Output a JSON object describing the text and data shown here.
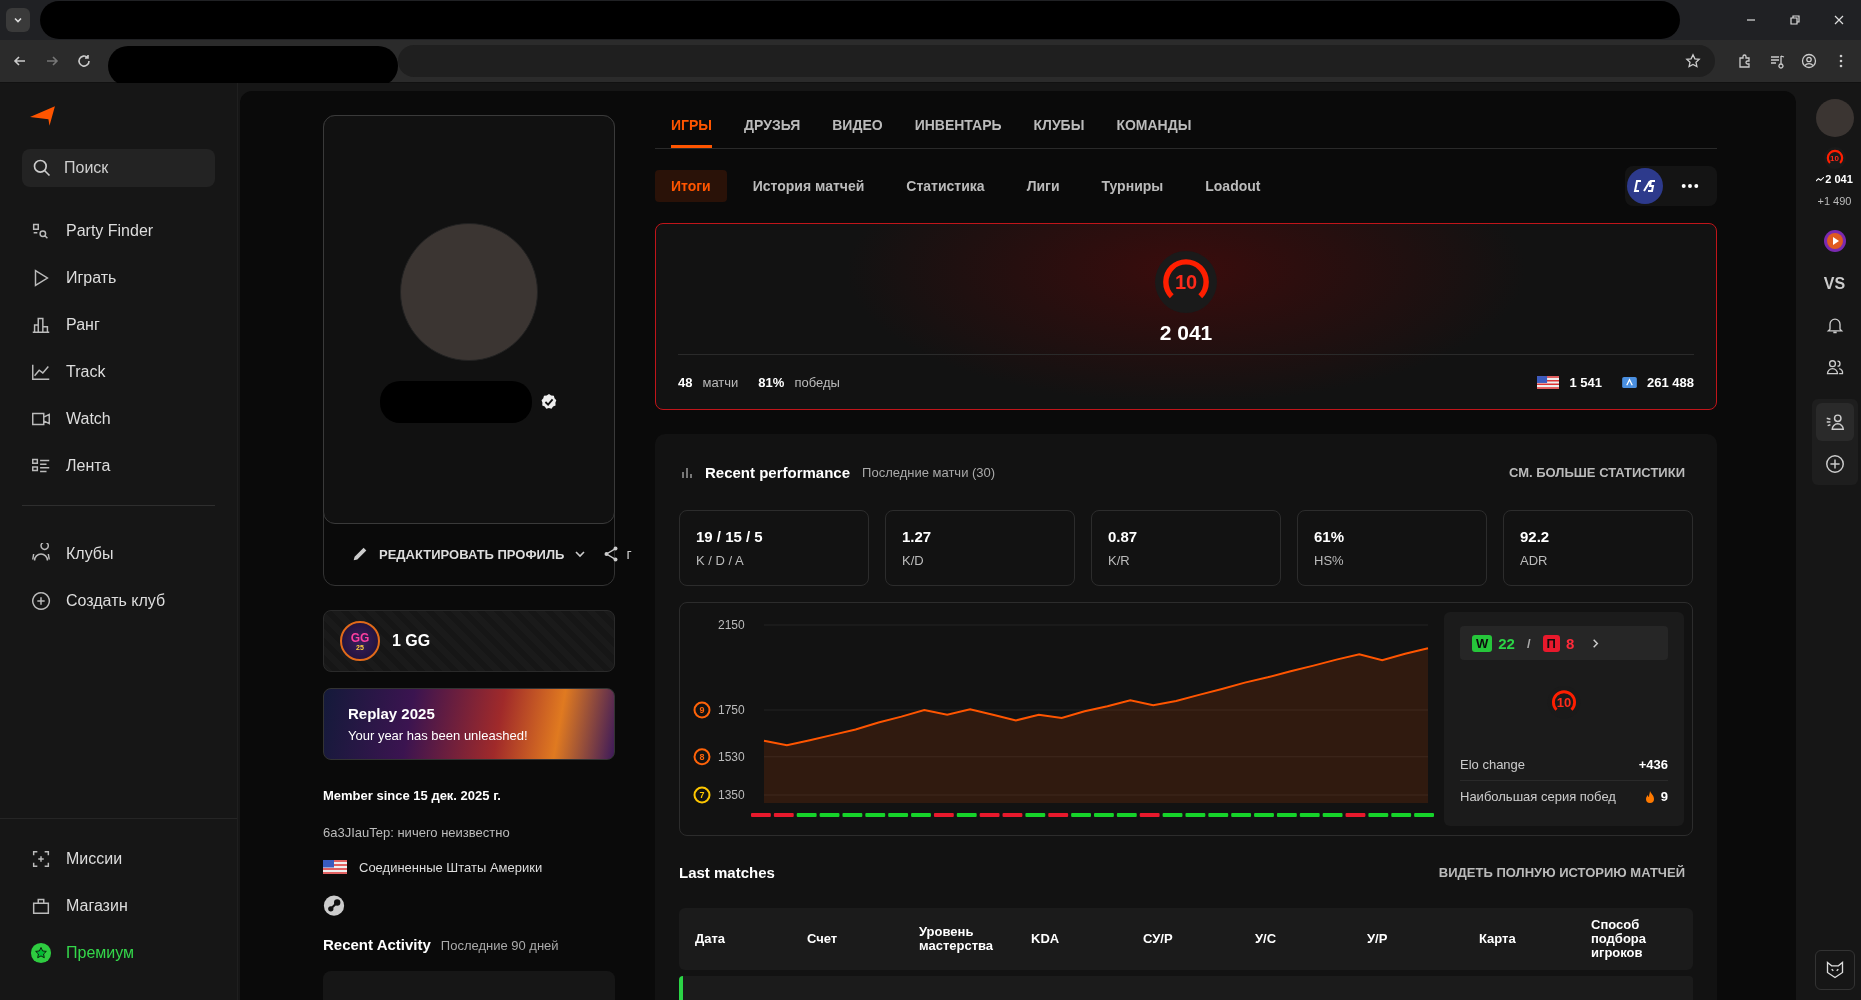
{
  "sidebar": {
    "search": {
      "placeholder": "Поиск"
    },
    "nav": [
      {
        "label": "Party Finder"
      },
      {
        "label": "Играть"
      },
      {
        "label": "Ранг"
      },
      {
        "label": "Track"
      },
      {
        "label": "Watch"
      },
      {
        "label": "Лента"
      }
    ],
    "clubs": [
      {
        "label": "Клубы"
      },
      {
        "label": "Создать клуб"
      }
    ],
    "bottom": [
      {
        "label": "Миссии",
        "kind": "normal"
      },
      {
        "label": "Магазин",
        "kind": "normal"
      },
      {
        "label": "Премиум",
        "kind": "premium"
      }
    ]
  },
  "profile": {
    "verified": true,
    "edit_button": "РЕДАКТИРОВАТЬ ПРОФИЛЬ",
    "share_label": "г",
    "gg_card": {
      "badge": "GG",
      "badge_year": "25",
      "label": "1 GG"
    },
    "replay": {
      "title": "Replay 2025",
      "subtitle": "Your year has been unleashed!"
    },
    "member_since": "Member since 15 дек. 2025 г.",
    "about": "6a3JIauTep: ничего неизвестно",
    "country": "Соединенные Штаты Америки",
    "recent_activity": {
      "title": "Recent Activity",
      "period": "Последние 90 дней"
    }
  },
  "tabs": [
    {
      "label": "ИГРЫ",
      "selected": true
    },
    {
      "label": "ДРУЗЬЯ",
      "selected": false
    },
    {
      "label": "ВИДЕО",
      "selected": false
    },
    {
      "label": "ИНВЕНТАРЬ",
      "selected": false
    },
    {
      "label": "КЛУБЫ",
      "selected": false
    },
    {
      "label": "КОМАНДЫ",
      "selected": false
    }
  ],
  "subtabs": [
    {
      "label": "Итоги",
      "selected": true
    },
    {
      "label": "История матчей",
      "selected": false
    },
    {
      "label": "Статистика",
      "selected": false
    },
    {
      "label": "Лиги",
      "selected": false
    },
    {
      "label": "Турниры",
      "selected": false
    },
    {
      "label": "Loadout",
      "selected": false
    }
  ],
  "rank": {
    "level": "10",
    "elo": "2 041",
    "matches": "48",
    "matches_label": "матчи",
    "winrate": "81%",
    "winrate_label": "победы",
    "country_rank": "1 541",
    "region_rank": "261 488"
  },
  "performance": {
    "title": "Recent performance",
    "subtitle": "Последние матчи (30)",
    "more_link": "СМ. БОЛЬШЕ СТАТИСТИКИ",
    "stats": [
      {
        "value": "19 / 15 / 5",
        "label": "K / D / A"
      },
      {
        "value": "1.27",
        "label": "K/D"
      },
      {
        "value": "0.87",
        "label": "K/R"
      },
      {
        "value": "61%",
        "label": "HS%"
      },
      {
        "value": "92.2",
        "label": "ADR"
      }
    ],
    "chart_data": {
      "type": "area",
      "ylim": [
        1350,
        2150
      ],
      "yticks": [
        1350,
        1530,
        1750,
        2150
      ],
      "series": [
        {
          "color": "#ff5500",
          "values": [
            1605,
            1584,
            1608,
            1633,
            1658,
            1691,
            1719,
            1750,
            1728,
            1753,
            1728,
            1701,
            1728,
            1713,
            1744,
            1768,
            1796,
            1772,
            1793,
            1821,
            1849,
            1879,
            1904,
            1932,
            1959,
            1987,
            2012,
            1984,
            2015,
            2041
          ]
        }
      ]
    },
    "level_badges": [
      {
        "text": "9",
        "color": "#ff6309"
      },
      {
        "text": "8",
        "color": "#ff6309"
      },
      {
        "text": "7",
        "color": "#fec700"
      }
    ],
    "match_results": [
      {
        "win": false
      },
      {
        "win": false
      },
      {
        "win": true
      },
      {
        "win": true
      },
      {
        "win": true
      },
      {
        "win": true
      },
      {
        "win": true
      },
      {
        "win": true
      },
      {
        "win": false
      },
      {
        "win": true
      },
      {
        "win": false
      },
      {
        "win": false
      },
      {
        "win": true
      },
      {
        "win": false
      },
      {
        "win": true
      },
      {
        "win": true
      },
      {
        "win": true
      },
      {
        "win": false
      },
      {
        "win": true
      },
      {
        "win": true
      },
      {
        "win": true
      },
      {
        "win": true
      },
      {
        "win": true
      },
      {
        "win": true
      },
      {
        "win": true
      },
      {
        "win": true
      },
      {
        "win": false
      },
      {
        "win": true
      },
      {
        "win": true
      },
      {
        "win": true
      }
    ],
    "summary": {
      "win_letter": "W",
      "wins": "22",
      "separator": "/",
      "loss_letter": "П",
      "losses": "8",
      "level": "10",
      "elo_change_label": "Elo change",
      "elo_change": "+436",
      "streak_label": "Наибольшая серия побед",
      "streak": "9"
    }
  },
  "last_matches": {
    "title": "Last matches",
    "link": "ВИДЕТЬ ПОЛНУЮ ИСТОРИЮ МАТЧЕЙ",
    "columns": [
      "Дата",
      "Счет",
      "Уровень мастерства",
      "KDA",
      "СУ/Р",
      "У/С",
      "У/Р",
      "Карта",
      "Способ подбора игроков"
    ]
  },
  "right_rail": {
    "level": "10",
    "elo": "2 041",
    "elo_gain": "+1 490",
    "vs": "VS"
  }
}
